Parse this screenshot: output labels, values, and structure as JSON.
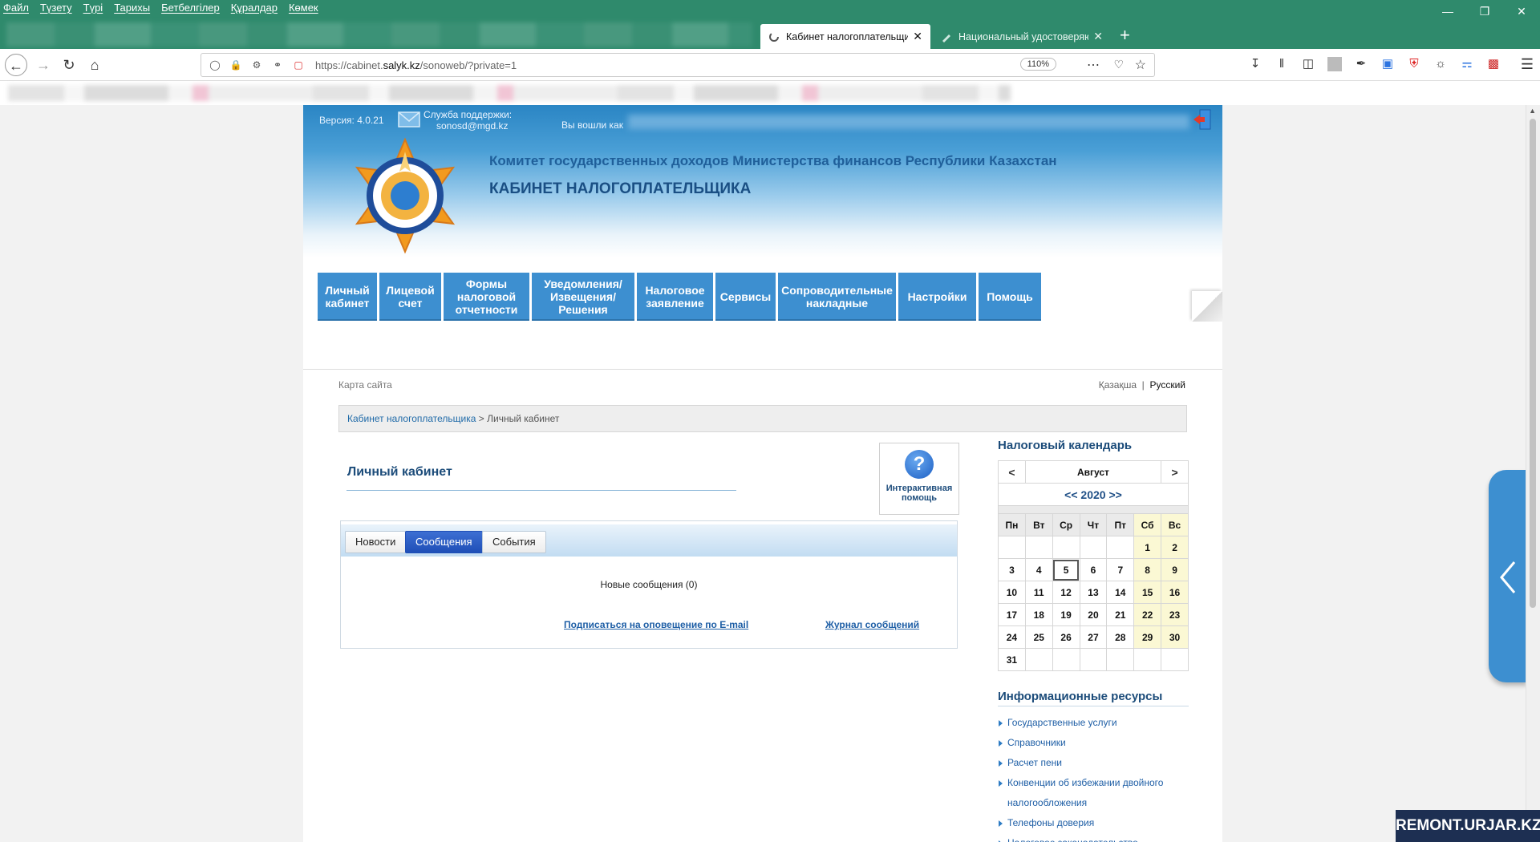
{
  "browser": {
    "menu": [
      "Файл",
      "Түзету",
      "Түрі",
      "Тарихы",
      "Бетбелгілер",
      "Құралдар",
      "Көмек"
    ],
    "tabs": [
      {
        "label": "Кабинет налогоплательщика",
        "active": true
      },
      {
        "label": "Национальный удостоверяющ",
        "active": false
      }
    ],
    "url_prefix": "https://cabinet.",
    "url_domain": "salyk.kz",
    "url_path": "/sonoweb/?private=1",
    "zoom": "110%",
    "accent_color": "#2f8a6c"
  },
  "header": {
    "version": "Версия: 4.0.21",
    "support_label": "Служба поддержки:",
    "support_email": "sonosd@mgd.kz",
    "logged_in_label": "Вы вошли как",
    "committee": "Комитет государственных доходов Министерства финансов Республики Казахстан",
    "title": "КАБИНЕТ НАЛОГОПЛАТЕЛЬЩИКА"
  },
  "nav": [
    {
      "label": "Личный\nкабинет",
      "width": 74
    },
    {
      "label": "Лицевой\nсчет",
      "width": 77
    },
    {
      "label": "Формы\nналоговой\nотчетности",
      "width": 107
    },
    {
      "label": "Уведомления/\nИзвещения/\nРешения",
      "width": 128
    },
    {
      "label": "Налоговое\nзаявление",
      "width": 95
    },
    {
      "label": "Сервисы",
      "width": 75
    },
    {
      "label": "Сопроводительные\nнакладные",
      "width": 147
    },
    {
      "label": "Настройки",
      "width": 97
    },
    {
      "label": "Помощь",
      "width": 78
    }
  ],
  "sitemap": "Карта сайта",
  "lang": {
    "kz": "Қазақша",
    "sep": "|",
    "ru": "Русский"
  },
  "breadcrumb": {
    "link": "Кабинет налогоплательщика",
    "sep": " > ",
    "current": "Личный кабинет"
  },
  "main": {
    "title": "Личный кабинет",
    "help": "Интерактивная\nпомощь",
    "tabs": [
      "Новости",
      "Сообщения",
      "События"
    ],
    "active_tab": "Сообщения",
    "new_messages": "Новые сообщения (0)",
    "subscribe_link": "Подписаться на оповещение по E-mail",
    "journal_link": "Журнал сообщений"
  },
  "calendar": {
    "title": "Налоговый календарь",
    "prev": "<",
    "next": ">",
    "month": "Август",
    "year_label": "<< 2020 >>",
    "weekdays": [
      "Пн",
      "Вт",
      "Ср",
      "Чт",
      "Пт",
      "Сб",
      "Вс"
    ],
    "weeks": [
      [
        "",
        "",
        "",
        "",
        "",
        "1",
        "2"
      ],
      [
        "3",
        "4",
        "5",
        "6",
        "7",
        "8",
        "9"
      ],
      [
        "10",
        "11",
        "12",
        "13",
        "14",
        "15",
        "16"
      ],
      [
        "17",
        "18",
        "19",
        "20",
        "21",
        "22",
        "23"
      ],
      [
        "24",
        "25",
        "26",
        "27",
        "28",
        "29",
        "30"
      ],
      [
        "31",
        "",
        "",
        "",
        "",
        "",
        ""
      ]
    ],
    "today": "5"
  },
  "info": {
    "title": "Информационные ресурсы",
    "items": [
      "Государственные услуги",
      "Справочники",
      "Расчет пени",
      "Конвенции об избежании двойного налогообложения",
      "Телефоны доверия",
      "Налоговое законодательство"
    ]
  },
  "watermark": "REMONT.URJAR.KZ"
}
